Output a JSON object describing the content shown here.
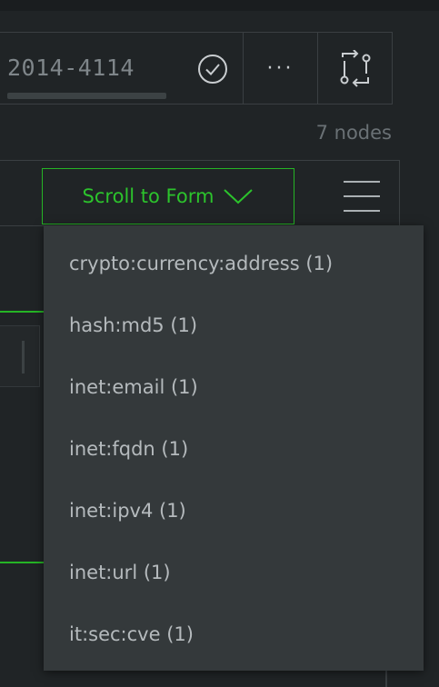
{
  "query": {
    "id_text": "2014-4114"
  },
  "header": {
    "check_icon": "check-circle-icon",
    "more_icon": "ellipsis-icon",
    "more_label": "···",
    "flow_icon": "git-compare-icon"
  },
  "stats": {
    "node_count": "7 nodes"
  },
  "toolbar": {
    "scroll_label": "Scroll to Form",
    "scroll_icon": "chevron-down-icon",
    "menu_icon": "hamburger-menu-icon"
  },
  "dropdown": {
    "items": [
      {
        "label": "crypto:currency:address (1)"
      },
      {
        "label": "hash:md5 (1)"
      },
      {
        "label": "inet:email (1)"
      },
      {
        "label": "inet:fqdn (1)"
      },
      {
        "label": "inet:ipv4 (1)"
      },
      {
        "label": "inet:url (1)"
      },
      {
        "label": "it:sec:cve (1)"
      }
    ]
  },
  "colors": {
    "background": "#202426",
    "accent_green": "#25b425",
    "dropdown_bg": "#34393b",
    "text_muted": "#7f868a"
  }
}
